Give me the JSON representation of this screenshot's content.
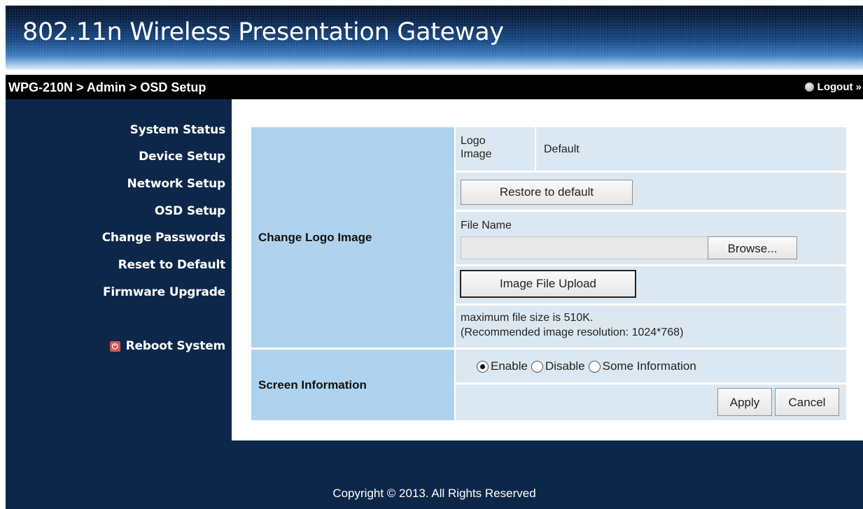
{
  "header": {
    "title": "802.11n Wireless Presentation Gateway"
  },
  "breadcrumb": {
    "path": "WPG-210N > Admin > OSD Setup",
    "logout_label": "Logout »"
  },
  "sidebar": {
    "items": [
      {
        "label": "System Status"
      },
      {
        "label": "Device Setup"
      },
      {
        "label": "Network Setup"
      },
      {
        "label": "OSD Setup"
      },
      {
        "label": "Change Passwords"
      },
      {
        "label": "Reset to Default"
      },
      {
        "label": "Firmware Upgrade"
      }
    ],
    "reboot_label": "Reboot System"
  },
  "form": {
    "logo_section": {
      "label": "Change Logo Image",
      "logo_image_label": "Logo Image",
      "logo_image_value": "Default",
      "restore_button": "Restore to default",
      "file_name_label": "File Name",
      "file_input_value": "",
      "browse_button": "Browse...",
      "upload_button": "Image File Upload",
      "note_line1": "maximum file size is 510K.",
      "note_line2": "(Recommended image resolution: 1024*768)"
    },
    "screen_section": {
      "label": "Screen Information",
      "options": [
        "Enable",
        "Disable",
        "Some Information"
      ],
      "selected": "Enable",
      "apply_button": "Apply",
      "cancel_button": "Cancel"
    }
  },
  "footer": {
    "copyright": "Copyright © 2013. All Rights Reserved"
  }
}
